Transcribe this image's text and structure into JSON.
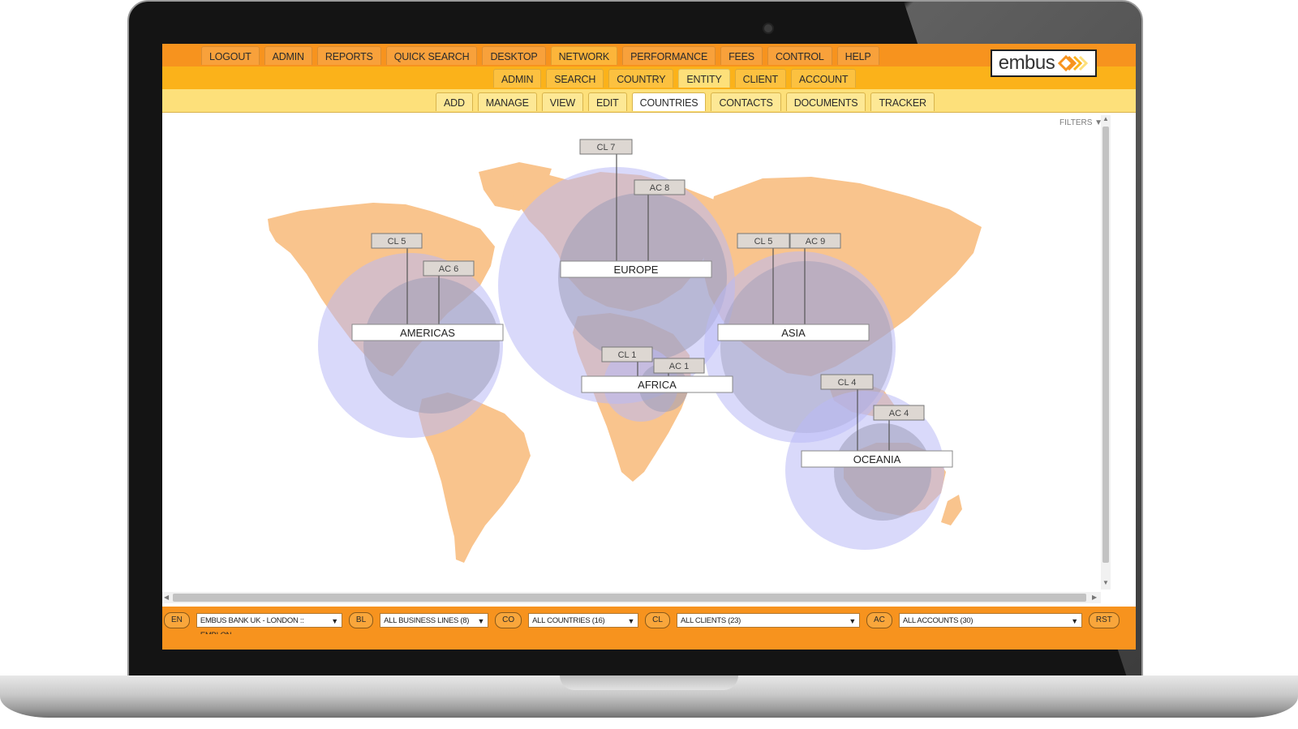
{
  "brand": {
    "name": "embus"
  },
  "nav": {
    "primary": [
      "LOGOUT",
      "ADMIN",
      "REPORTS",
      "QUICK SEARCH",
      "DESKTOP",
      "NETWORK",
      "PERFORMANCE",
      "FEES",
      "CONTROL",
      "HELP"
    ],
    "secondary": [
      "ADMIN",
      "SEARCH",
      "COUNTRY",
      "ENTITY",
      "CLIENT",
      "ACCOUNT"
    ],
    "tertiary": [
      "ADD",
      "MANAGE",
      "VIEW",
      "EDIT",
      "COUNTRIES",
      "CONTACTS",
      "DOCUMENTS",
      "TRACKER"
    ],
    "active_primary": "NETWORK",
    "active_secondary": "ENTITY",
    "active_tertiary": "COUNTRIES"
  },
  "filters_label": "FILTERS ▼",
  "regions": [
    {
      "name": "AMERICAS",
      "cl": "CL 5",
      "ac": "AC 6"
    },
    {
      "name": "EUROPE",
      "cl": "CL 7",
      "ac": "AC 8"
    },
    {
      "name": "AFRICA",
      "cl": "CL 1",
      "ac": "AC 1"
    },
    {
      "name": "ASIA",
      "cl": "CL 5",
      "ac": "AC 9"
    },
    {
      "name": "OCEANIA",
      "cl": "CL 4",
      "ac": "AC 4"
    }
  ],
  "bottom": {
    "lang": "EN",
    "entity": "EMBUS BANK UK - LONDON :: EMBLON",
    "bl_label": "BL",
    "business_lines": "ALL BUSINESS LINES (8)",
    "co_label": "CO",
    "countries": "ALL COUNTRIES (16)",
    "cl_label": "CL",
    "clients": "ALL CLIENTS (23)",
    "ac_label": "AC",
    "accounts": "ALL ACCOUNTS (30)",
    "reset": "RST"
  },
  "colors": {
    "orange": "#f7931e",
    "amber": "#fbb21a",
    "pale": "#fde07a",
    "land": "#f9c48d",
    "bubble_outer": "#b9b9f5",
    "bubble_inner": "#9c9cb8"
  }
}
